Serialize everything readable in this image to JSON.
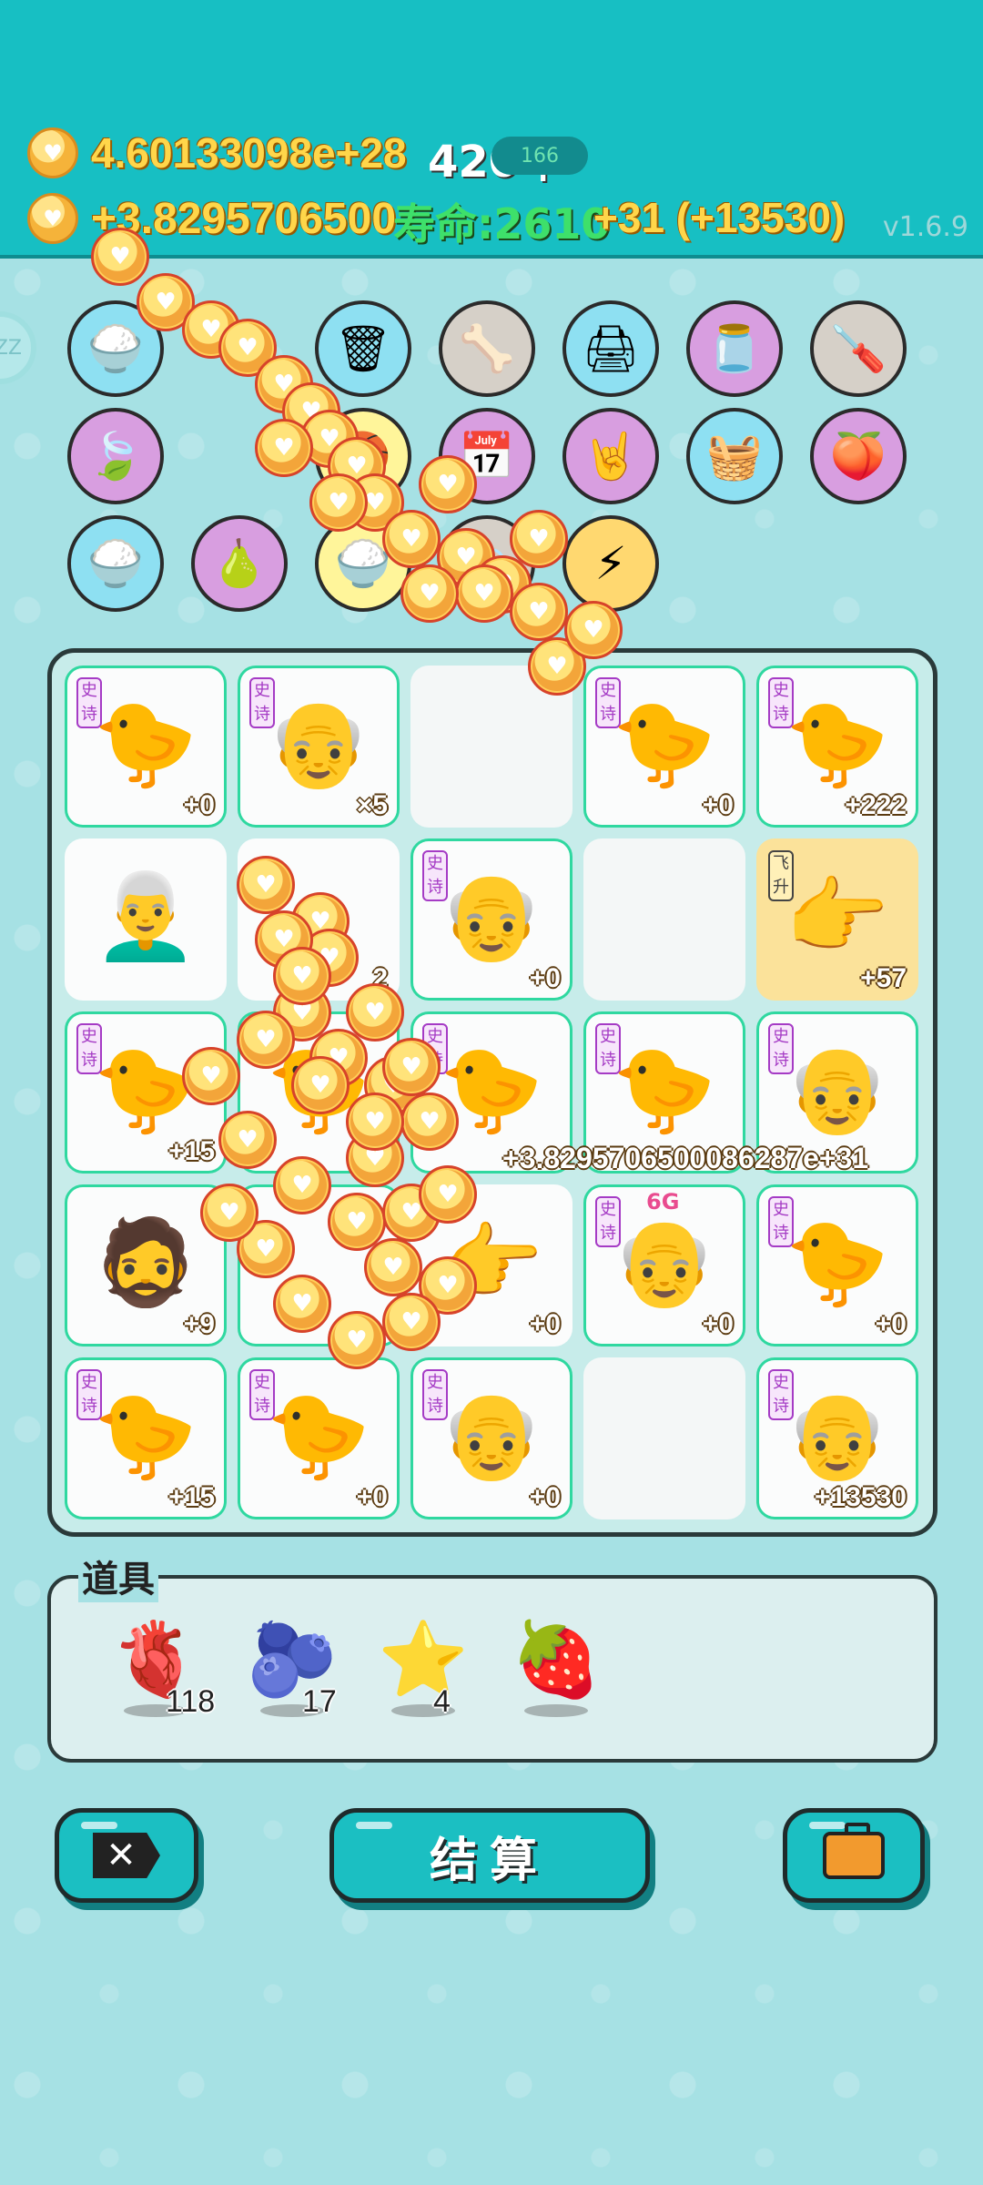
{
  "header": {
    "money_total": "4.60133098e+28",
    "year": "420年",
    "level": "166",
    "money_income": "+3.8295706500",
    "life_label": "寿命:2610",
    "income_suffix": "+31  (+13530)",
    "version": "v1.6.9"
  },
  "sleep_badge": "ZZ",
  "items": [
    {
      "icon": "rice-bowl-icon",
      "glyph": "🍚",
      "color": "blue"
    },
    {
      "icon": "trash-bag-icon",
      "glyph": "🗑",
      "color": "blue"
    },
    {
      "icon": "pet-food-icon",
      "glyph": "🦴",
      "color": "gray"
    },
    {
      "icon": "printer-icon",
      "glyph": "🖨",
      "color": "blue"
    },
    {
      "icon": "jar-icon",
      "glyph": "🫙",
      "color": "purple"
    },
    {
      "icon": "screwdriver-icon",
      "glyph": "🪛",
      "color": "gray"
    },
    {
      "icon": "leaf-icon",
      "glyph": "🍃",
      "color": "purple"
    },
    {
      "icon": "basketball-icon",
      "glyph": "🏀",
      "color": "yellow"
    },
    {
      "icon": "calendar-icon",
      "glyph": "📅",
      "color": "purple"
    },
    {
      "icon": "rock-hand-icon",
      "glyph": "🤘",
      "color": "purple"
    },
    {
      "icon": "fruit-basket-icon",
      "glyph": "🧺",
      "color": "blue"
    },
    {
      "icon": "eyepatch-icon",
      "glyph": "🍑",
      "color": "purple"
    },
    {
      "icon": "rice-bowl-icon",
      "glyph": "🍚",
      "color": "blue"
    },
    {
      "icon": "guava-icon",
      "glyph": "🍐",
      "color": "purple"
    },
    {
      "icon": "rice-bowl-icon",
      "glyph": "🍚",
      "color": "yellow"
    },
    {
      "icon": "leaf-icon",
      "glyph": "🍃",
      "color": "gray"
    },
    {
      "icon": "lightning-icon",
      "glyph": "⚡",
      "color": "gold"
    }
  ],
  "board": {
    "cells": [
      {
        "tag": "史诗",
        "face": "🐤",
        "bonus": "+0"
      },
      {
        "tag": "史诗",
        "face": "👴",
        "bonus": "×5"
      },
      {
        "tag": "",
        "face": "",
        "bonus": "",
        "empty": true
      },
      {
        "tag": "史诗",
        "face": "🐤",
        "bonus": "+0"
      },
      {
        "tag": "史诗",
        "face": "🐤",
        "bonus": "+222"
      },
      {
        "tag": "",
        "face": "👨‍🦳",
        "bonus": "",
        "plain": true
      },
      {
        "tag": "",
        "face": "",
        "bonus": "2",
        "plain": true
      },
      {
        "tag": "史诗",
        "face": "👴",
        "bonus": "+0"
      },
      {
        "tag": "",
        "face": "",
        "bonus": "",
        "empty": true
      },
      {
        "tag": "飞升",
        "face": "👉",
        "bonus": "+57",
        "gold": true
      },
      {
        "tag": "史诗",
        "face": "🐤",
        "bonus": "+15"
      },
      {
        "tag": "",
        "face": "🐤",
        "bonus": ""
      },
      {
        "tag": "史诗",
        "face": "🐤",
        "bonus": ""
      },
      {
        "tag": "史诗",
        "face": "🐤",
        "bonus": ""
      },
      {
        "tag": "史诗",
        "face": "👴",
        "bonus": ""
      },
      {
        "tag": "",
        "face": "🧔",
        "bonus": "+9"
      },
      {
        "tag": "",
        "face": "",
        "bonus": ""
      },
      {
        "tag": "",
        "face": "👉",
        "bonus": "+0",
        "plain": true
      },
      {
        "tag": "史诗",
        "face": "👴",
        "bonus": "+0",
        "badge": "6G"
      },
      {
        "tag": "史诗",
        "face": "🐤",
        "bonus": "+0"
      },
      {
        "tag": "史诗",
        "face": "🐤",
        "bonus": "+15"
      },
      {
        "tag": "史诗",
        "face": "🐤",
        "bonus": "+0"
      },
      {
        "tag": "史诗",
        "face": "👴",
        "bonus": "+0"
      },
      {
        "tag": "",
        "face": "",
        "bonus": "",
        "empty": true
      },
      {
        "tag": "史诗",
        "face": "👴",
        "bonus": "+13530"
      }
    ],
    "floating_number": "+3.8295706500086287e+31"
  },
  "props": {
    "title": "道具",
    "items": [
      {
        "icon": "liver-icon",
        "glyph": "🫀",
        "count": "118"
      },
      {
        "icon": "blueberry-icon",
        "glyph": "🫐",
        "count": "17"
      },
      {
        "icon": "star-icon",
        "glyph": "⭐",
        "count": "4"
      },
      {
        "icon": "strawberry-icon",
        "glyph": "🍓",
        "count": ""
      }
    ]
  },
  "buttons": {
    "close_glyph": "✕",
    "settle_label": "结算"
  }
}
